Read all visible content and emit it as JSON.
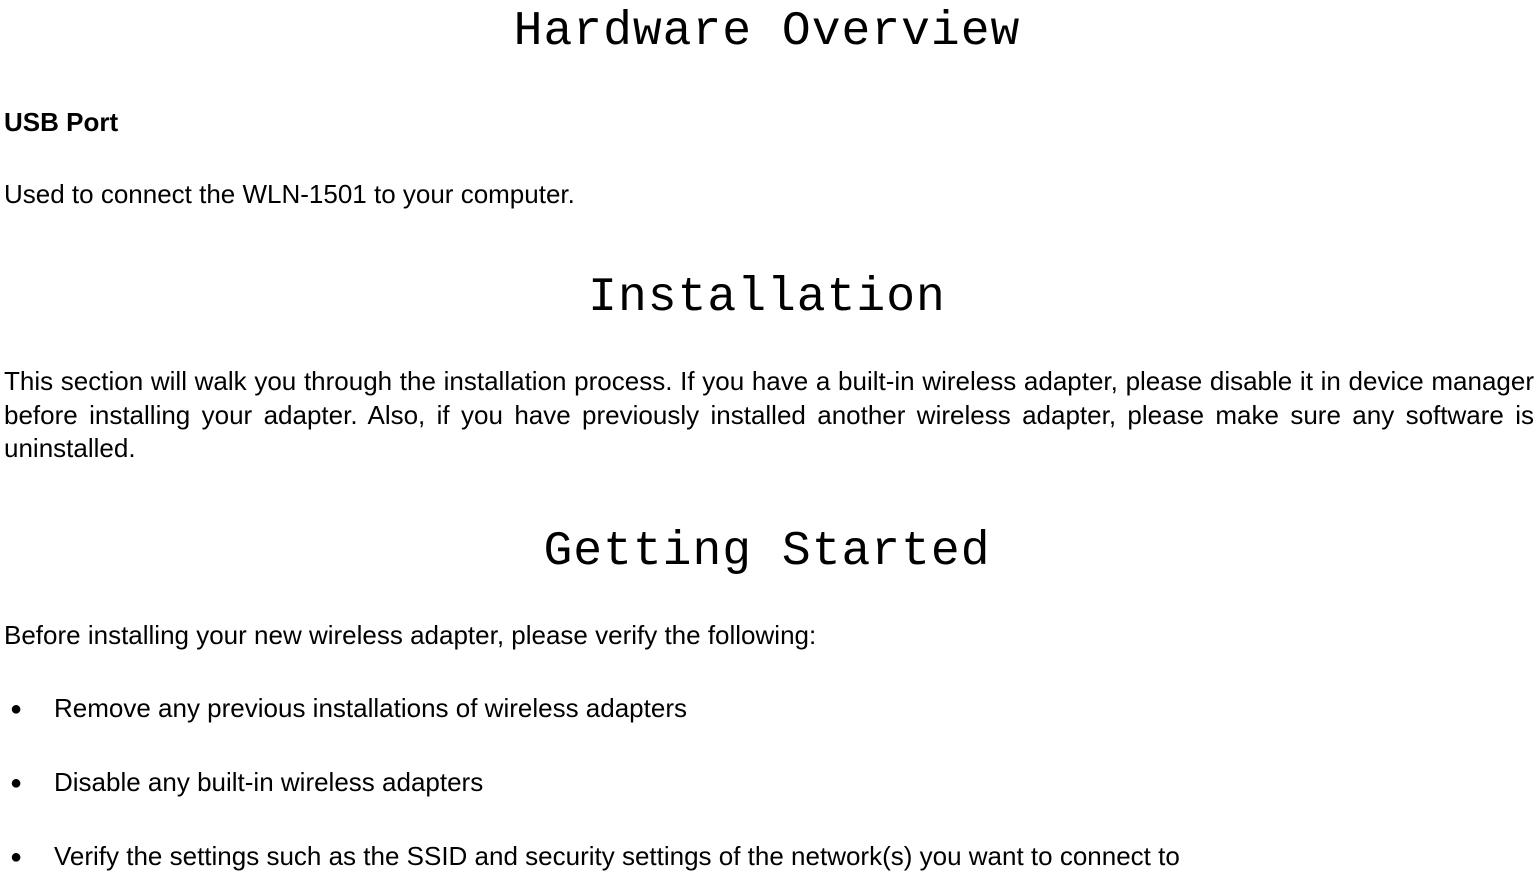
{
  "headings": {
    "hardware_overview": "Hardware Overview",
    "installation": "Installation",
    "getting_started": "Getting Started"
  },
  "usb_port": {
    "label": "USB Port",
    "description": "Used to connect the WLN-1501 to your computer."
  },
  "installation_text": "This section will walk you through the installation process. If you have a built-in wireless adapter, please disable it in device manager before installing your adapter. Also, if you have previously installed another wireless adapter, please make sure any software is uninstalled.",
  "getting_started": {
    "intro": "Before installing your new wireless adapter, please verify the following:",
    "bullets": [
      "Remove any previous installations of wireless adapters",
      "Disable any built-in wireless adapters",
      "Verify the settings such as the SSID and security settings of the network(s) you want to connect to"
    ]
  }
}
